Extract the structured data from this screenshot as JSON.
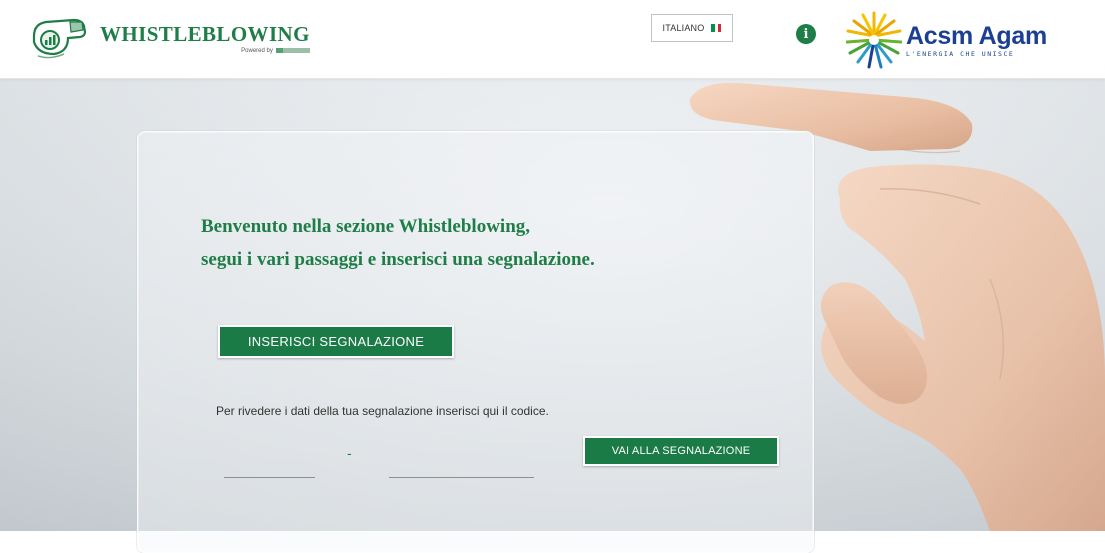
{
  "header": {
    "brand_title": "WHISTLEBLOWING",
    "brand_powered": "Powered by",
    "brand_icon": "whistle-icon",
    "language": {
      "label": "ITALIANO",
      "flag_icon": "italy-flag-icon",
      "flag_colors": [
        "#009246",
        "#ffffff",
        "#ce2b37"
      ]
    },
    "info_icon": "info-icon",
    "partner_logo": {
      "name": "Acsm Agam",
      "tagline": "L'ENERGIA CHE UNISCE",
      "icon": "sunburst-logo-icon"
    }
  },
  "main": {
    "welcome_line1": "Benvenuto nella sezione Whistleblowing,",
    "welcome_line2": "segui i vari passaggi e inserisci una segnalazione.",
    "insert_button": "INSERISCI SEGNALAZIONE",
    "review_hint": "Per rivedere i dati della tua segnalazione inserisci qui il codice.",
    "code_separator": "-",
    "code_part1_value": "",
    "code_part2_value": "",
    "go_button": "VAI ALLA SEGNALAZIONE"
  },
  "colors": {
    "brand_green": "#1f7d48",
    "button_green": "#1a7b47",
    "acsm_blue": "#1d3f93"
  }
}
